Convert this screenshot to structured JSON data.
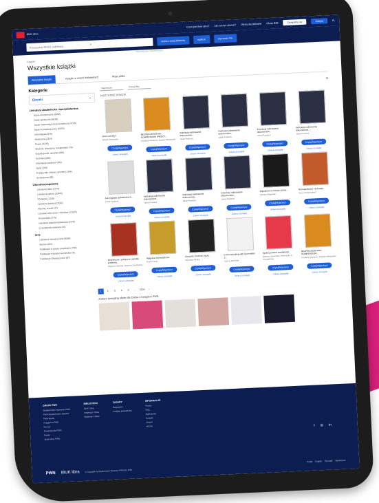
{
  "topbar": {
    "brand": "IBUK Libra",
    "links": [
      "Czym jest Ibuk Libra?",
      "Jak zacząć używać?",
      "Oferta dla biblioteki",
      "Oferta B2B"
    ],
    "btn_register": "Zarejestruj się",
    "btn_login": "Zaloguj",
    "lang": "PL"
  },
  "search": {
    "placeholder": "Przeszukaj 96252 publikacji...",
    "hint": "Wyszukiwanie zaawansowane",
    "btn_library": "Wybierz swoją bibliotekę",
    "btn_mybook": "myIBUK",
    "btn_access": "Wprowadź PIN"
  },
  "page": {
    "crumb": "Książki",
    "title": "Wszystkie książki",
    "tabs": [
      "Wszystkie książki",
      "Książki w moich bibliotekach",
      "Moja półka"
    ]
  },
  "sidebar": {
    "heading": "Kategorie",
    "sub": "Ebooki",
    "sec1": "Literatura akademicka i specjalistyczna",
    "items1": [
      "Nauki ekonomiczne (5096)",
      "Nauki społeczne (6038)",
      "Nauki matematyczno-przyrodnicze (3726)",
      "Nauki humanistyczne (10379)",
      "Informatyka (976)",
      "Medycyna (2324)",
      "Prawo (4230)",
      "Słowniki, leksykony, kompendia (179)",
      "Encyklopedie, słowniki (366)",
      "Technika (486)",
      "Informacje naukowe (591)",
      "Sport (756)",
      "Podręczniki i lektury szkolne (1366)",
      "Architektura (86)"
    ],
    "sec2": "Literatura popularna",
    "items2": [
      "Literatura faktu (2179)",
      "Literatura piękna (10095)",
      "Poradniki (1326)",
      "Literatura kobieca (2932)",
      "Albumy, sztuka (27)",
      "Literatura dla dzieci i młodzieży (1025)",
      "Przewodniki (175)",
      "Literatura popularnonaukowa (1376)",
      "Czasopisma naukowe (42)"
    ],
    "sec3": "Inne",
    "items3": [
      "Literatura obcojęzyczna (8326)",
      "Biznes (262)",
      "Publikacje w języku angielskim (740)",
      "Publikacje w języku niemieckim (6)",
      "Publikacje Obcojęzyczne (87)"
    ]
  },
  "list": {
    "sort_label": "Najnowsze",
    "filter_label": "Pokaż filtry",
    "section_title": "WSZYSTKIE KSIĄŻKI",
    "borrow": "Czytaj/Wypożycz",
    "details": "Zobacz szczegóły",
    "books": [
      {
        "title": "Sens estetyka",
        "author": "Monika Wąsowska",
        "color": "#d9cfbf"
      },
      {
        "title": "BEZPIECZEŃSTWO. KOMPENDIUM WIEDZY...",
        "author": "Redakcja Naukowa: Bogdan Wiśniewski",
        "color": "#d98b1f"
      },
      {
        "title": "Instrukcja nalizowania dokumentów...",
        "author": "Jakub Postarek",
        "color": "#2a2f44"
      },
      {
        "title": "Instrukcja nalizowania dokumentów...",
        "author": "Jakub Postarek",
        "color": "#2a2f44"
      },
      {
        "title": "Instrukcja nalizowania dokumentów...",
        "author": "Jakub Postarek",
        "color": "#2a2f44"
      },
      {
        "title": "Instrukcja nalizowania dokumentów...",
        "author": "Jakub Postarek",
        "color": "#2a2f44"
      },
      {
        "title": "Jak wygląda spółdzielnia w...",
        "author": "Jakub Postarek",
        "color": "#dcdcdc"
      },
      {
        "title": "Instrukcja nalizowania dokumentów...",
        "author": "Jakub Postarek",
        "color": "#2a2f44"
      },
      {
        "title": "Instrukcja nalizowania dokumentów...",
        "author": "Jakub Postarek",
        "color": "#2a2f44"
      },
      {
        "title": "Instrukcja nalizowania dokumentów...",
        "author": "Jakub Postarek",
        "color": "#2a2f44"
      },
      {
        "title": "Wypalenie w miejscu pracy...",
        "author": "Andrzej Wąsowski",
        "color": "#1a1a1a"
      },
      {
        "title": "Retrospektywa i dziesiąty...",
        "author": "Teresa Dobrowolska",
        "color": "#c25a2c"
      },
      {
        "title": "Filozoficzne i polityczne aspekty problemu...",
        "author": "Wojciech Okoński, Zbigniew Drozdowicz",
        "color": "#a83222"
      },
      {
        "title": "Wygranie Nieświadome",
        "author": "Paweł Lubaś",
        "color": "#c89c2b"
      },
      {
        "title": "Gwiazdo. Podróże życia...",
        "author": "Stanisław Fijałek",
        "color": "#222222"
      },
      {
        "title": "Communicating with Generation Z...",
        "author": "Joanna Dzieńska",
        "color": "#f2f2f2"
      },
      {
        "title": "Społeczeństwo współpracy",
        "author": "Barbara Jawornicka, Aleksandra A. Przegalińska",
        "color": "#e63a4a"
      },
      {
        "title": "BEZPIECZEŃSTWO KOMPENDIUM...",
        "author": "Redakcja Naukowa: Bogdan Wiśniewski",
        "color": "#d98b1f"
      }
    ]
  },
  "pager": [
    "1",
    "2",
    "3",
    "4",
    "5",
    "...",
    "3126",
    "›"
  ],
  "promo": {
    "title": "Zobacz specjalną ofertę dla Ciebie z księgarni PWN",
    "covers": [
      "#e8e0d6",
      "#d84a7a",
      "#e3e0db",
      "#d2a7a2",
      "#e8e8ec",
      "#1c1c2e"
    ]
  },
  "footer": {
    "cols": [
      {
        "head": "GRUPA PWN",
        "items": [
          "Wydawnictwo Naukowe PWN",
          "PWN Wydawnictwo Szkolne",
          "PWN Media",
          "Księgarnia PWN",
          "Kurs.pl",
          "Encyklopedia PWN",
          "Nauka",
          "Język obcy PWN"
        ]
      },
      {
        "head": "BIBLIOTEKA",
        "items": [
          "IBUK Libra",
          "Instytucja i firma",
          "Wybieraj z oferty"
        ]
      },
      {
        "head": "ZASADY",
        "items": [
          "Regulamin",
          "Polityka prywatności"
        ]
      },
      {
        "head": "INFORMACJE",
        "items": [
          "Pomoc",
          "FAQ",
          "Ogłoszenia",
          "Kontakt",
          "Zespół",
          "WCAG"
        ]
      }
    ],
    "brand1": "PWN",
    "brand2": "IBUK libra",
    "copy": "© Copyright by Wydawnictwo Naukowe PWN SA, 2023",
    "langs": [
      "Polski",
      "English",
      "Pусский",
      "Українська"
    ]
  }
}
